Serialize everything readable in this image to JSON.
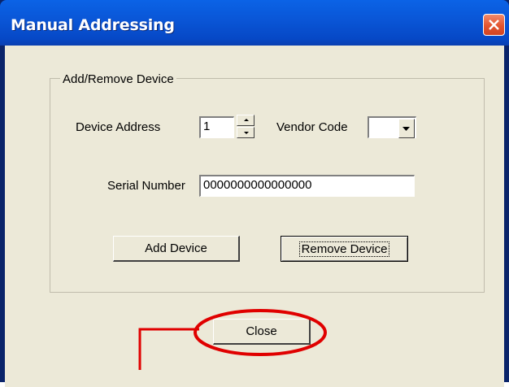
{
  "window": {
    "title": "Manual Addressing",
    "close_icon": "close-x-icon"
  },
  "group": {
    "legend": "Add/Remove Device",
    "device_address_label": "Device Address",
    "device_address_value": "1",
    "vendor_code_label": "Vendor Code",
    "vendor_code_value": "",
    "serial_number_label": "Serial Number",
    "serial_number_value": "0000000000000000"
  },
  "buttons": {
    "add_device": "Add Device",
    "remove_device": "Remove Device",
    "close": "Close"
  },
  "annotation": {
    "highlight_color": "#e00000"
  }
}
